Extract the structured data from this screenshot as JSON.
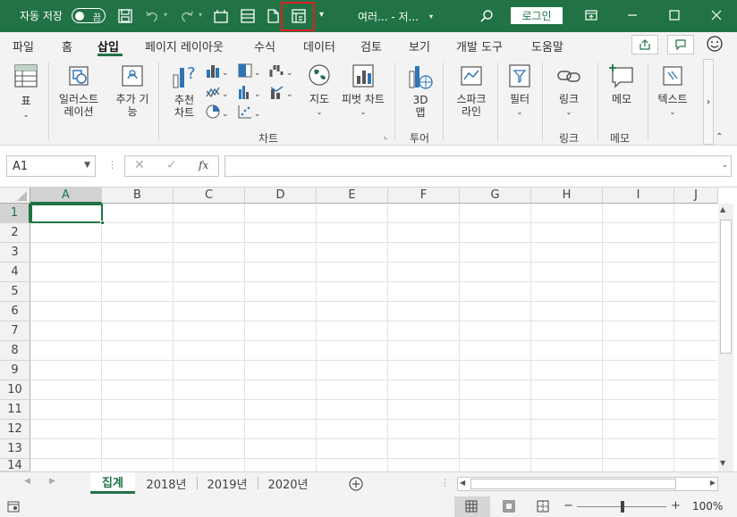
{
  "titlebar": {
    "autosave_label": "자동 저장",
    "autosave_toggle": "끔",
    "doc_title": "여러...  -  저...",
    "login_label": "로그인"
  },
  "icons": {
    "save": "save-icon",
    "undo": "undo-icon",
    "redo": "redo-icon",
    "qat1": "calendar-frame-icon",
    "qat2": "layout-icon",
    "qat3": "new-page-icon",
    "qat4": "form-icon",
    "search": "search-icon"
  },
  "menu": {
    "tabs": [
      "파일",
      "홈",
      "삽입",
      "페이지 레이아웃",
      "수식",
      "데이터",
      "검토",
      "보기",
      "개발 도구",
      "도움말"
    ],
    "active_tab": "삽입"
  },
  "ribbon": {
    "table": "표",
    "illustrations": "일러스트\n레이션",
    "addins": "추가 기\n능",
    "recommended_charts": "추천\n차트",
    "maps": "지도",
    "pivot_chart": "피벗 차트",
    "map3d": "3D\n맵",
    "sparklines": "스파크\n라인",
    "filters": "필터",
    "link": "링크",
    "comment": "메모",
    "text": "텍스트",
    "group_charts": "차트",
    "group_tours": "투어",
    "group_links": "링크",
    "group_comments": "메모"
  },
  "formula": {
    "namebox": "A1",
    "fx": "fx",
    "value": ""
  },
  "sheet": {
    "columns": [
      "A",
      "B",
      "C",
      "D",
      "E",
      "F",
      "G",
      "H",
      "I",
      "J"
    ],
    "rows": [
      "1",
      "2",
      "3",
      "4",
      "5",
      "6",
      "7",
      "8",
      "9",
      "10",
      "11",
      "12",
      "13",
      "14"
    ],
    "active_cell": "A1"
  },
  "sheets": {
    "tabs": [
      "집계",
      "2018년",
      "2019년",
      "2020년"
    ],
    "active": "집계"
  },
  "status": {
    "zoom": "100%"
  },
  "colors": {
    "accent": "#217346",
    "highlight": "#e02020"
  }
}
